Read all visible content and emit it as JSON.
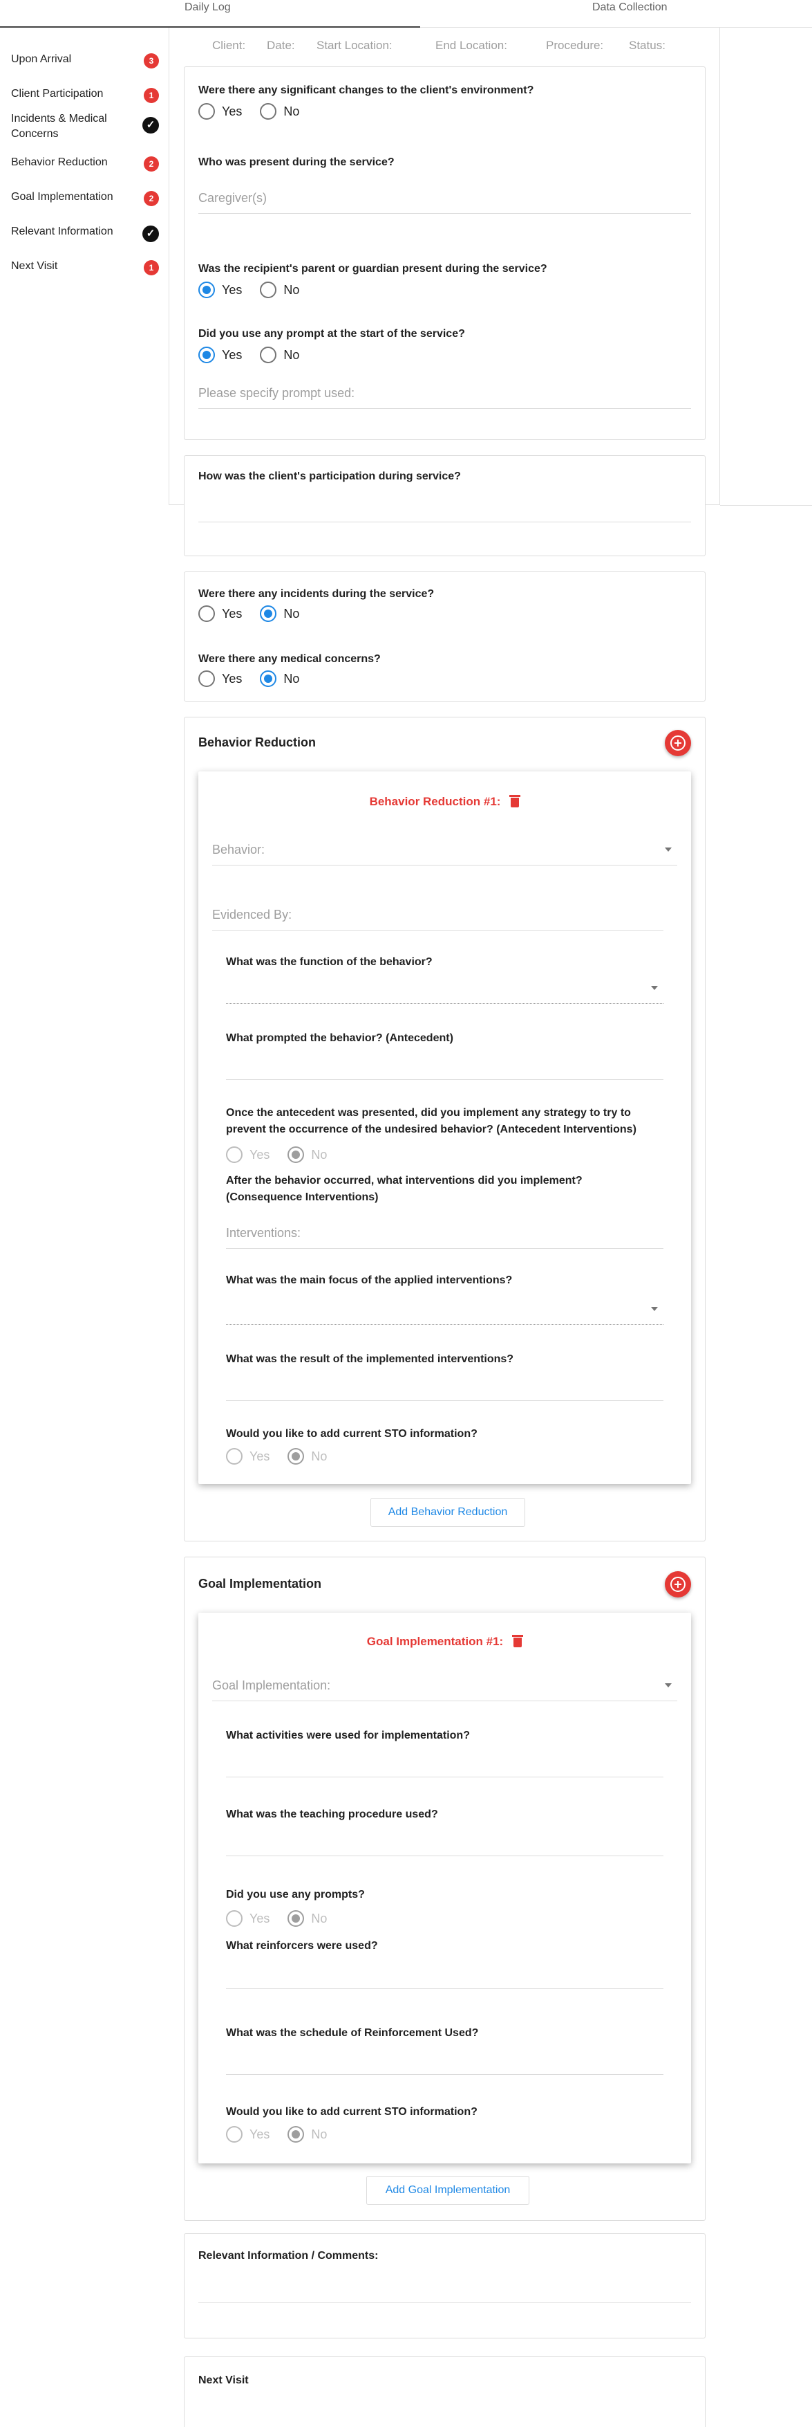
{
  "tabs": {
    "daily_log": "Daily Log",
    "data_collection": "Data Collection"
  },
  "sidebar": {
    "items": [
      {
        "label": "Upon Arrival",
        "badge": "3"
      },
      {
        "label": "Client Participation",
        "badge": "1"
      },
      {
        "label": "Incidents & Medical Concerns",
        "status": "complete"
      },
      {
        "label": "Behavior Reduction",
        "badge": "2"
      },
      {
        "label": "Goal Implementation",
        "badge": "2"
      },
      {
        "label": "Relevant Information",
        "status": "complete"
      },
      {
        "label": "Next Visit",
        "badge": "1"
      }
    ]
  },
  "header": {
    "client": "Client:",
    "date": "Date:",
    "start": "Start Location:",
    "end": "End Location:",
    "procedure": "Procedure:",
    "status": "Status:"
  },
  "radio_labels": {
    "yes": "Yes",
    "no": "No"
  },
  "upon_arrival": {
    "q1": "Were there any significant changes to the client's environment?",
    "q2": "Who was present during the service?",
    "caregivers_placeholder": "Caregiver(s)",
    "q3": "Was the recipient's parent or guardian present during the service?",
    "q4": "Did you use any prompt at the start of the service?",
    "prompt_placeholder": "Please specify prompt used:"
  },
  "participation": {
    "q": "How was the client's participation during service?"
  },
  "incidents": {
    "q1": "Were there any incidents during the service?",
    "q2": "Were there any medical concerns?"
  },
  "behavior_reduction": {
    "title": "Behavior Reduction",
    "item_title": "Behavior Reduction #1:",
    "behavior_placeholder": "Behavior:",
    "evidenced_placeholder": "Evidenced By:",
    "q_function": "What was the function of the behavior?",
    "q_antecedent": "What prompted the behavior? (Antecedent)",
    "q_strategy": "Once the antecedent was presented, did you implement any strategy to try to prevent the occurrence of the undesired behavior? (Antecedent Interventions)",
    "q_consequence": "After the behavior occurred, what interventions did you implement? (Consequence Interventions)",
    "interventions_placeholder": "Interventions:",
    "q_focus": "What was the main focus of the applied interventions?",
    "q_result": "What was the result of the implemented interventions?",
    "q_sto": "Would you like to add current STO information?",
    "add_button": "Add Behavior Reduction"
  },
  "goal_implementation": {
    "title": "Goal Implementation",
    "item_title": "Goal Implementation #1:",
    "goal_placeholder": "Goal Implementation:",
    "q_activities": "What activities were used for implementation?",
    "q_teaching": "What was the teaching procedure used?",
    "q_prompts": "Did you use any prompts?",
    "q_reinforcers": "What reinforcers were used?",
    "q_schedule": "What was the schedule of Reinforcement Used?",
    "q_sto": "Would you like to add current STO information?",
    "add_button": "Add Goal Implementation"
  },
  "relevant": {
    "title": "Relevant Information / Comments:"
  },
  "next_visit": {
    "title": "Next Visit"
  },
  "colors": {
    "accent": "#1e88e5",
    "alert": "#e53935"
  }
}
